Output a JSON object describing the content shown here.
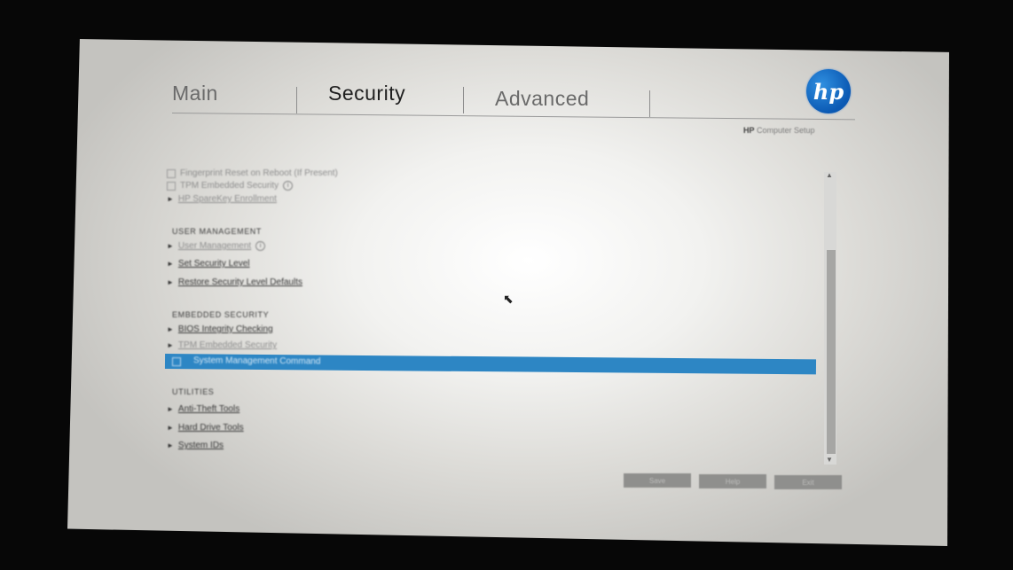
{
  "tabs": [
    "Main",
    "Security",
    "Advanced"
  ],
  "logo": {
    "text": "hp",
    "caption_bold": "HP",
    "caption": "Computer Setup"
  },
  "items_top": [
    {
      "label": "Fingerprint Reset on Reboot (If Present)",
      "type": "checkbox"
    },
    {
      "label": "TPM Embedded Security",
      "type": "checkbox"
    },
    {
      "label": "HP SpareKey Enrollment",
      "type": "link"
    }
  ],
  "sections": {
    "user_management": "USER MANAGEMENT",
    "embedded_security": "EMBEDDED SECURITY",
    "utilities": "UTILITIES"
  },
  "user_management_items": [
    "User Management",
    "Set Security Level",
    "Restore Security Level Defaults"
  ],
  "embedded_security_items": [
    "BIOS Integrity Checking",
    "TPM Embedded Security"
  ],
  "highlighted_item": "System Management Command",
  "utilities_items": [
    "Anti-Theft Tools",
    "Hard Drive Tools",
    "System IDs"
  ],
  "buttons": [
    "Save",
    "Help",
    "Exit"
  ],
  "colors": {
    "accent": "#2d86c4",
    "logo": "#0b59b3"
  }
}
